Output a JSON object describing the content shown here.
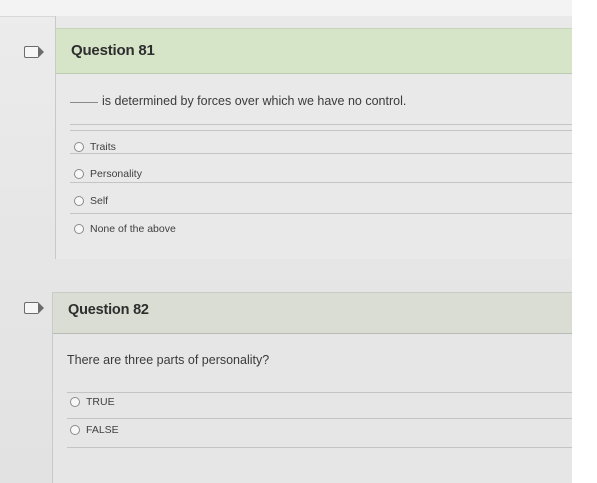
{
  "questions": [
    {
      "title": "Question 81",
      "prompt": "is determined by forces over which we have no control.",
      "options": [
        "Traits",
        "Personality",
        "Self",
        "None of the above"
      ]
    },
    {
      "title": "Question 82",
      "prompt": "There are three parts of personality?",
      "options": [
        "TRUE",
        "FALSE"
      ]
    }
  ],
  "icons": {
    "flag": "flag-icon",
    "radio": "radio-circle"
  },
  "colors": {
    "header_q81": "#d6e4c8",
    "header_q82": "#d9ddd4",
    "background": "#e6e6e6"
  }
}
